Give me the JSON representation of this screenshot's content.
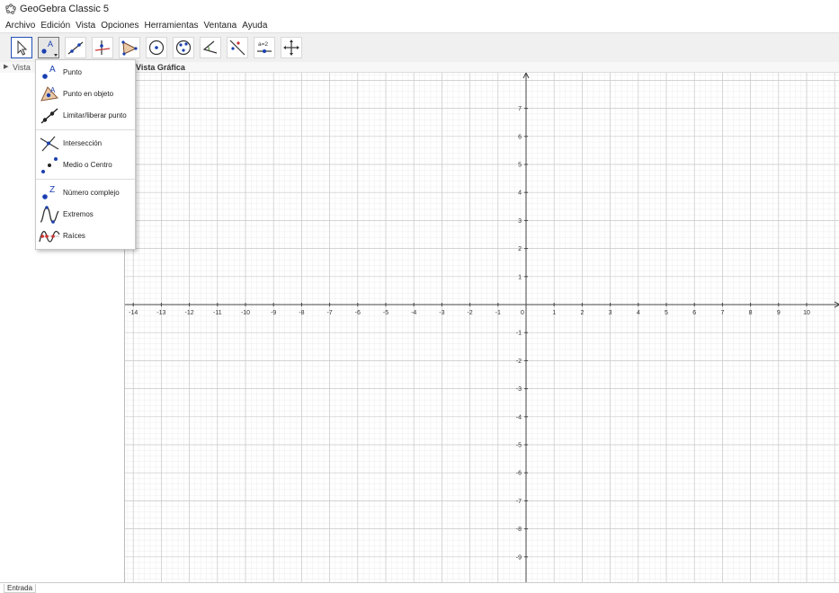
{
  "window": {
    "title": "GeoGebra Classic 5"
  },
  "menu": [
    "Archivo",
    "Edición",
    "Vista",
    "Opciones",
    "Herramientas",
    "Ventana",
    "Ayuda"
  ],
  "toolbar": {
    "toolcount": 11,
    "selected_tool": "move-tool",
    "active_tool": "point-tool",
    "slider_label": "a=2"
  },
  "algebra_view": {
    "title": "Vista"
  },
  "graphics_view": {
    "title": "Vista Gráfica"
  },
  "dropdown": {
    "items": [
      {
        "label": "Punto",
        "icon": "point-icon"
      },
      {
        "label": "Punto en objeto",
        "icon": "point-on-object-icon"
      },
      {
        "label": "Limitar/liberar punto",
        "icon": "attach-detach-point-icon"
      },
      {
        "label": "Intersección",
        "icon": "intersect-icon"
      },
      {
        "label": "Medio o Centro",
        "icon": "midpoint-icon"
      },
      {
        "label": "Número complejo",
        "icon": "complex-number-icon"
      },
      {
        "label": "Extremos",
        "icon": "extremum-icon"
      },
      {
        "label": "Raíces",
        "icon": "roots-icon"
      }
    ],
    "icon_letters": {
      "point": "A",
      "point_on_object": "A",
      "complex": "Z"
    }
  },
  "axes": {
    "x_range": [
      -14,
      10
    ],
    "y_range": [
      -9,
      7
    ],
    "grid": true,
    "axis_color": "#444444",
    "grid_color_major": "#c8c8c8",
    "grid_color_minor": "#ececec"
  },
  "input_bar": {
    "label": "Entrada"
  },
  "colors": {
    "point_blue": "#1a3fb0",
    "point_dark": "#222222",
    "accent_selected": "#1f4fb8"
  }
}
